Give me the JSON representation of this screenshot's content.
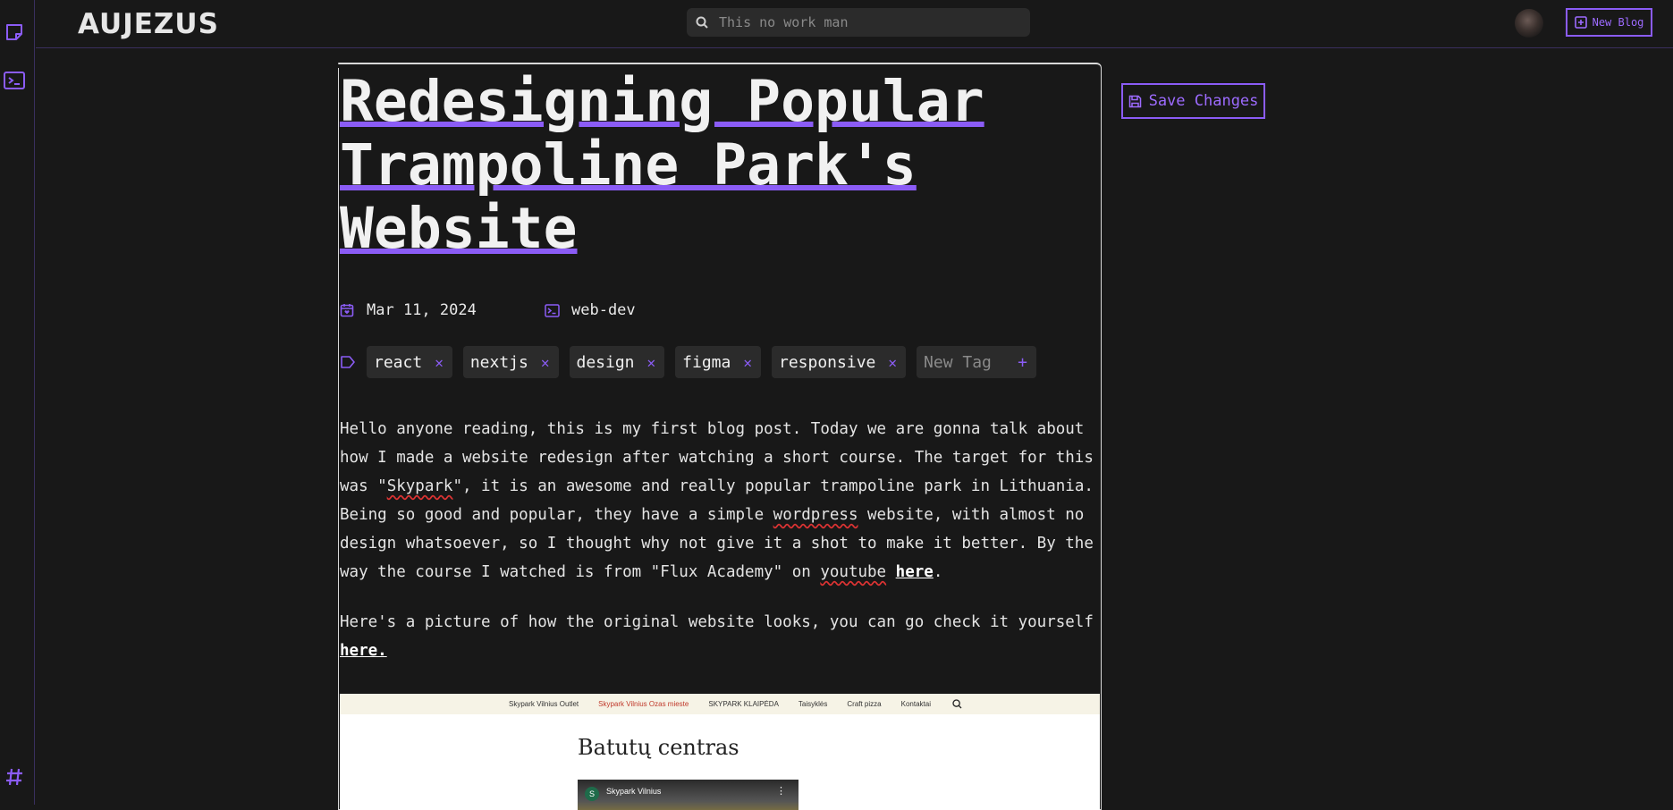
{
  "brand": "AUJEZUS",
  "search": {
    "placeholder": "This no work man"
  },
  "header": {
    "new_blog_label": "New Blog"
  },
  "post": {
    "title": "Redesigning Popular Trampoline Park's Website",
    "date": "Mar 11, 2024",
    "category": "web-dev",
    "tags": [
      "react",
      "nextjs",
      "design",
      "figma",
      "responsive"
    ],
    "new_tag_placeholder": "New Tag",
    "paragraph1": {
      "a": "Hello anyone reading, this is my first blog post. Today we are gonna talk about how I made a website redesign after watching a short course. The target for this was \"",
      "skypark": "Skypark",
      "b": "\", it is an awesome and really popular trampoline park in Lithuania. Being so good and popular, they have a simple ",
      "wordpress": "wordpress",
      "c": " website, with almost no design whatsoever, so I thought why not give it a shot to make it better. By the way the course I watched is from \"Flux Academy\" on ",
      "youtube": "youtube",
      "d": " ",
      "link": "here",
      "e": "."
    },
    "paragraph2": {
      "a": "Here's a picture of how the original website looks, you can go check it yourself ",
      "link": "here."
    }
  },
  "screenshot": {
    "nav": [
      "Skypark Vilnius Outlet",
      "Skypark Vilnius Ozas mieste",
      "SKYPARK KLAIPĖDA",
      "Taisyklės",
      "Craft pizza",
      "Kontaktai"
    ],
    "heading": "Batutų centras",
    "video_channel_initial": "S",
    "video_channel": "Skypark Vilnius"
  },
  "actions": {
    "save_label": "Save Changes"
  },
  "colors": {
    "accent": "#8b5cf6",
    "background": "#181818",
    "chip": "#2b2b2b"
  }
}
